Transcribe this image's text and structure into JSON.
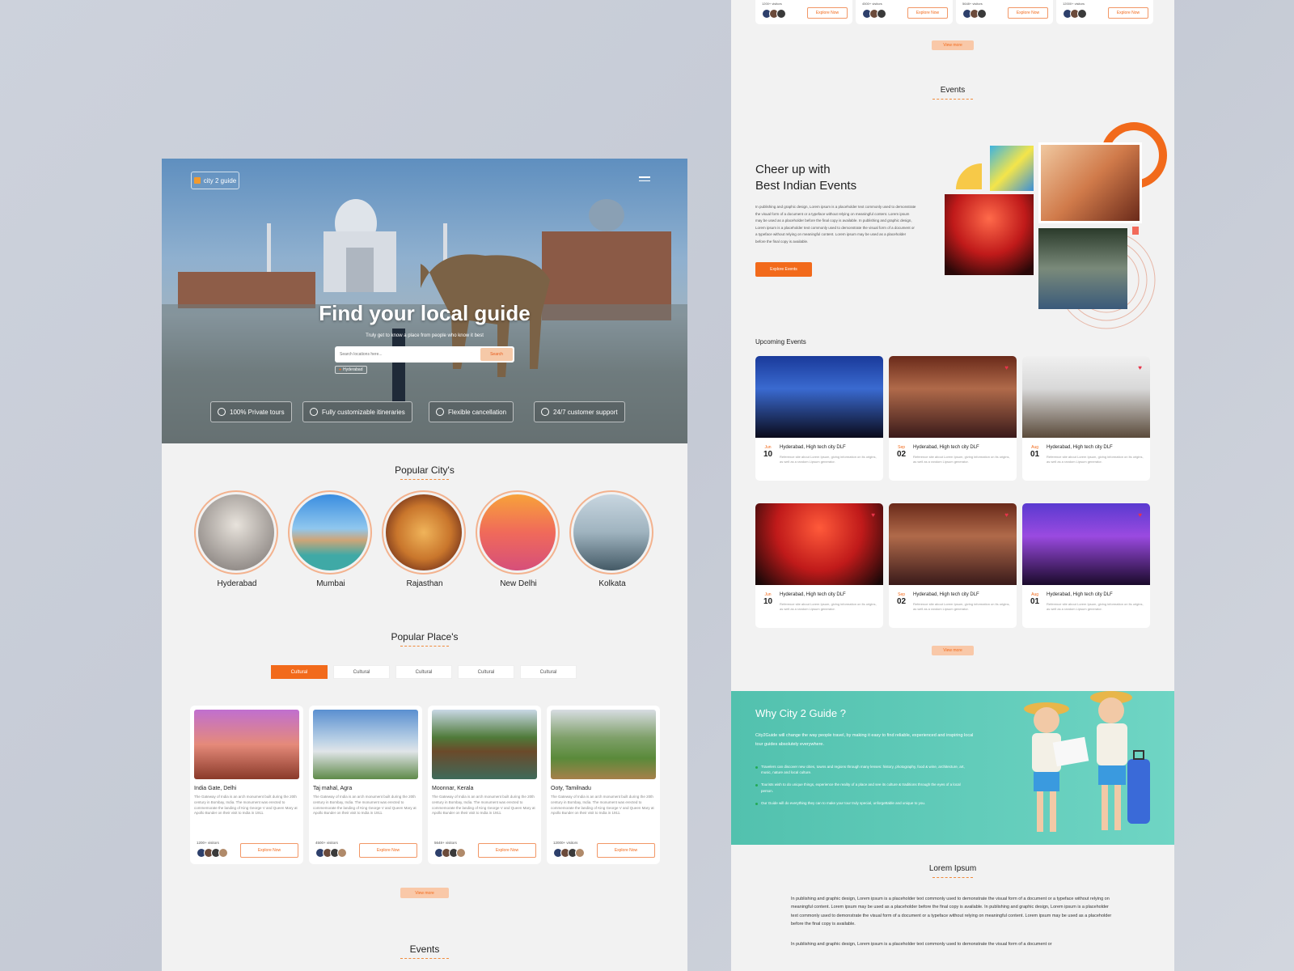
{
  "left": {
    "logo": "city 2 guide",
    "hero": {
      "title": "Find your  local guide",
      "subtitle": "Truly get to know a place from people who know it best",
      "search_placeholder": "Search locations here...",
      "search_button": "Search",
      "location_chip": "Hyderabad"
    },
    "features": [
      "100% Private tours",
      "Fully customizable itineraries",
      "Flexible cancellation",
      "24/7 customer support"
    ],
    "popular_cities_title": "Popular City's",
    "cities": [
      "Hyderabad",
      "Mumbai",
      "Rajasthan",
      "New Delhi",
      "Kolkata"
    ],
    "popular_places_title": "Popular Place's",
    "tabs": [
      "Cultural",
      "Cultural",
      "Cultural",
      "Cultural",
      "Cultural"
    ],
    "places": [
      {
        "title": "India Gate, Delhi",
        "visitors": "1200+ visitors",
        "button": "Explore Now"
      },
      {
        "title": "Taj mahal, Agra",
        "visitors": "4500+ visitors",
        "button": "Explore Now"
      },
      {
        "title": "Moonnar, Kerala",
        "visitors": "5648+ visitors",
        "button": "Explore Now"
      },
      {
        "title": "Ooty, Tamilnadu",
        "visitors": "12000+ visitors",
        "button": "Explore Now"
      }
    ],
    "place_description": "The Gateway of India is an arch monument built during the 20th century in Bombay, India. The monument was erected to commemorate the landing of King George V and Queen Mary at Apollo Bunder on their visit to India in 1911.",
    "view_more": "View more",
    "events_title": "Events"
  },
  "right": {
    "top_cards": [
      {
        "visitors": "1200+ visitors",
        "button": "Explore Now"
      },
      {
        "visitors": "4500+ visitors",
        "button": "Explore Now"
      },
      {
        "visitors": "5648+ visitors",
        "button": "Explore Now"
      },
      {
        "visitors": "12000+ visitors",
        "button": "Explore Now"
      }
    ],
    "view_more": "View more",
    "events_title": "Events",
    "cheer_title_1": "Cheer up with",
    "cheer_title_2": "Best Indian Events",
    "cheer_text": "In publishing and graphic design, Lorem ipsum is a placeholder text commonly used to demonstrate the visual form of a document or a typeface without relying on meaningful content. Lorem ipsum may be used as a placeholder before the final copy is available. In publishing and graphic design, Lorem ipsum is a placeholder text commonly used to demonstrate the visual form of a document or a typeface without relying on meaningful content. Lorem ipsum may be used as a placeholder before the final copy is available.",
    "explore_events": "Explore Events",
    "upcoming_title": "Upcoming Events",
    "events": [
      {
        "month": "Jun",
        "day": "10",
        "title": "Hyderabad, High tech city DLF"
      },
      {
        "month": "Sep",
        "day": "02",
        "title": "Hyderabad, High tech city DLF"
      },
      {
        "month": "Aug",
        "day": "01",
        "title": "Hyderabad, High tech city DLF"
      },
      {
        "month": "Jun",
        "day": "10",
        "title": "Hyderabad, High tech city DLF"
      },
      {
        "month": "Sep",
        "day": "02",
        "title": "Hyderabad, High tech city DLF"
      },
      {
        "month": "Aug",
        "day": "01",
        "title": "Hyderabad, High tech city DLF"
      }
    ],
    "event_description": "Reference site about Lorem Ipsum, giving information on its origins, as well as a random Lipsum generator.",
    "why_title": "Why City 2 Guide ?",
    "why_lead": "City2Guide will change the way people travel, by making it easy to find  reliable, experienced and inspiring local tour guides absolutely  everywhere.",
    "why_points": [
      "Travelers can discover new cities, towns and regions through many lenses: history, photography, food & wine, architecture, art, music, nature and  local culture.",
      "Tourists wish to do unique things, experience the reality of a place and see its culture & traditions through the eyes of a local person.",
      "Our Guide will do everything they can to make your tour truly special,  unforgettable and unique to you."
    ],
    "lorem_title": "Lorem Ipsum",
    "lorem_para_1": "In publishing and graphic design, Lorem ipsum is a placeholder text commonly used to demonstrate the visual form of a document or a typeface without relying on meaningful content. Lorem ipsum may be used as a placeholder before the final copy is available. In publishing and graphic design, Lorem ipsum is a placeholder text commonly used to demonstrate the visual form of a document or a typeface without relying on meaningful content. Lorem ipsum may be used as a placeholder before the final copy is available.",
    "lorem_para_2": "In publishing and graphic design, Lorem ipsum is a placeholder text commonly used to demonstrate the visual form of a document or"
  }
}
